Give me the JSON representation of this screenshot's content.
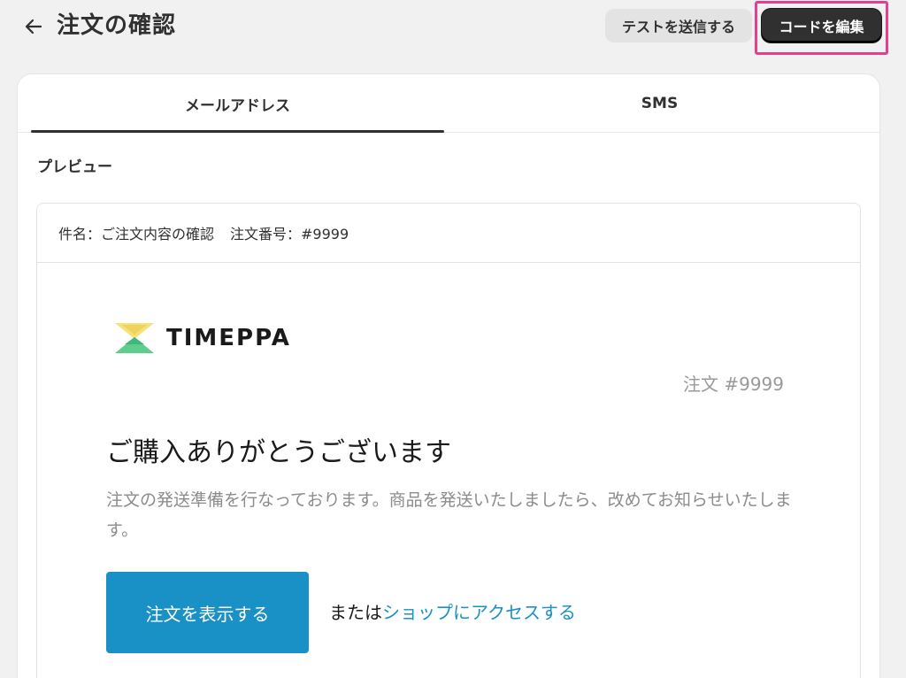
{
  "header": {
    "title": "注文の確認",
    "send_test_label": "テストを送信する",
    "edit_code_label": "コードを編集"
  },
  "tabs": [
    {
      "label": "メールアドレス",
      "selected": true
    },
    {
      "label": "SMS",
      "selected": false
    }
  ],
  "preview": {
    "section_title": "プレビュー",
    "subject_label": "件名：ご注文内容の確認",
    "order_number_label": "注文番号：#9999",
    "brand_name": "TIMEPPA",
    "order_ref": "注文 #9999",
    "heading": "ご購入ありがとうございます",
    "body": "注文の発送準備を行なっております。商品を発送いたしましたら、改めてお知らせいたします。",
    "cta_label": "注文を表示する",
    "or_text": "または",
    "shop_link_label": "ショップにアクセスする"
  },
  "colors": {
    "accent": "#1990c6",
    "highlight": "#e83e8c",
    "primary_button": "#303030"
  }
}
